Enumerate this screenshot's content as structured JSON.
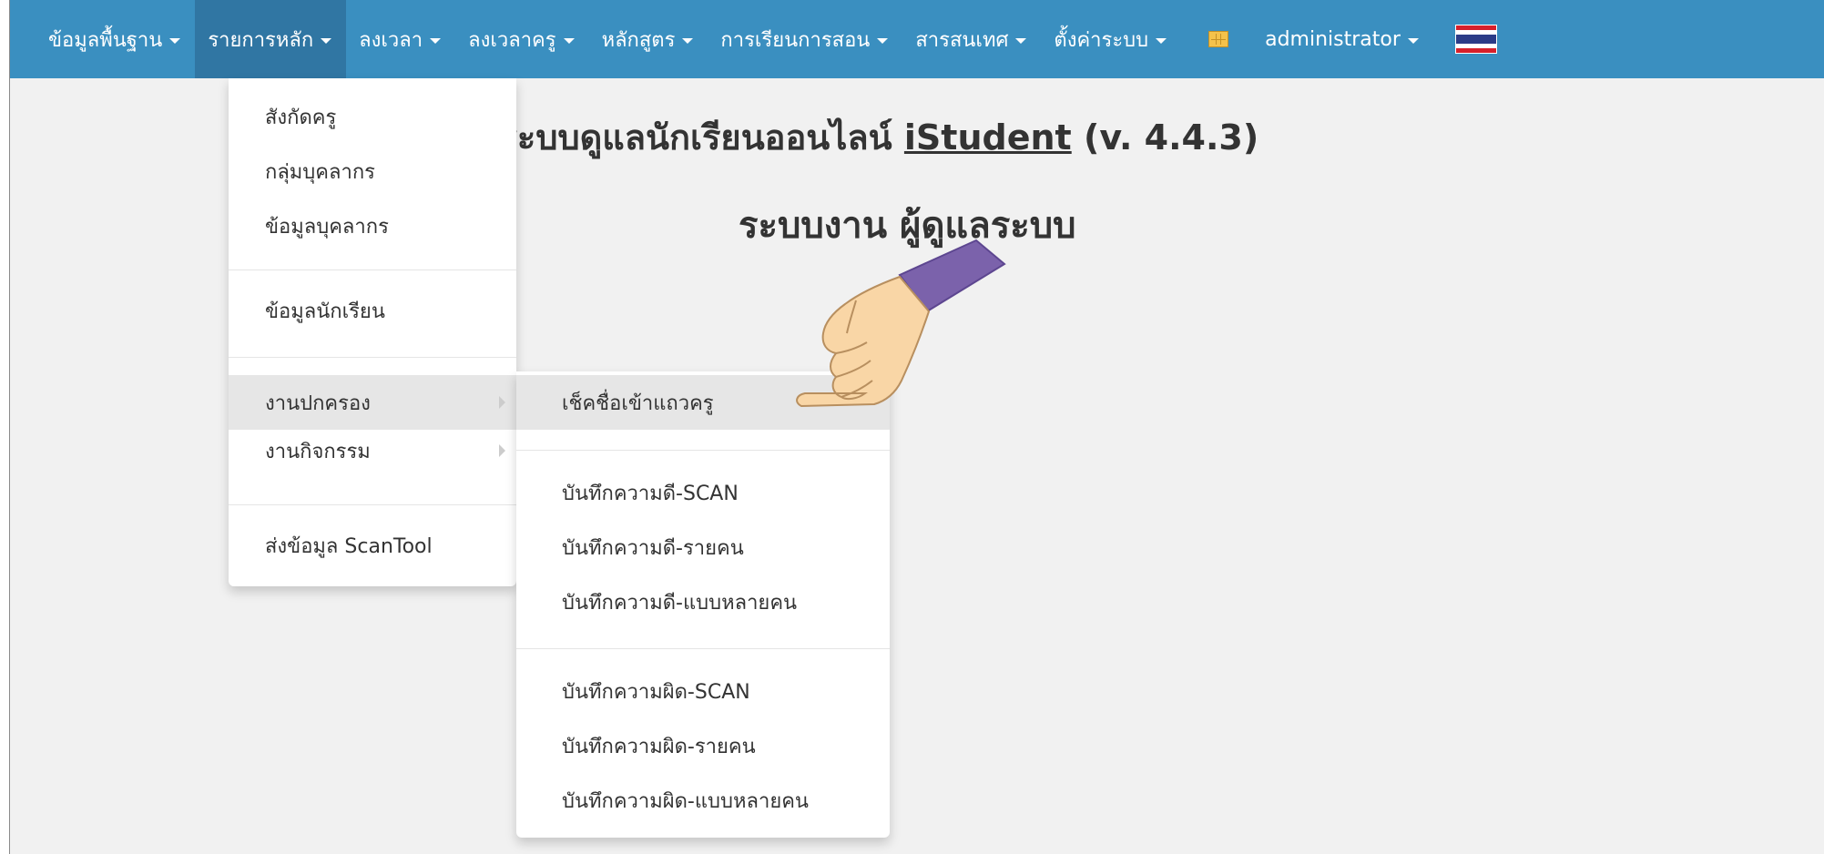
{
  "navbar": {
    "items": [
      {
        "label": "ข้อมูลพื้นฐาน"
      },
      {
        "label": "รายการหลัก"
      },
      {
        "label": "ลงเวลา"
      },
      {
        "label": "ลงเวลาครู"
      },
      {
        "label": "หลักสูตร"
      },
      {
        "label": "การเรียนการสอน"
      },
      {
        "label": "สารสนเทศ"
      },
      {
        "label": "ตั้งค่าระบบ"
      }
    ],
    "apps_icon": "grid-icon",
    "user": "administrator",
    "language_flag": "thai-flag-icon"
  },
  "main": {
    "welcome_prefix": "อนรับสู่ระบบดูแลนักเรียนออนไลน์",
    "welcome_brand": "iStudent",
    "welcome_version": "(v. 4.4.3)",
    "role_title": "ระบบงาน ผู้ดูแลระบบ"
  },
  "dropdown": {
    "items": [
      {
        "label": "สังกัดครู"
      },
      {
        "label": "กลุ่มบุคลากร"
      },
      {
        "label": "ข้อมูลบุคลากร"
      },
      {
        "label": "ข้อมูลนักเรียน"
      },
      {
        "label": "งานปกครอง"
      },
      {
        "label": "งานกิจกรรม"
      },
      {
        "label": "ส่งข้อมูล ScanTool"
      }
    ]
  },
  "submenu": {
    "items": [
      {
        "label": "เช็คชื่อเข้าแถวครู"
      },
      {
        "label": "บันทึกความดี-SCAN"
      },
      {
        "label": "บันทึกความดี-รายคน"
      },
      {
        "label": "บันทึกความดี-แบบหลายคน"
      },
      {
        "label": "บันทึกความผิด-SCAN"
      },
      {
        "label": "บันทึกความผิด-รายคน"
      },
      {
        "label": "บันทึกความผิด-แบบหลายคน"
      }
    ]
  },
  "colors": {
    "navbar": "#3a8fc0",
    "navbar_active": "#3076a3",
    "background": "#f1f1f1",
    "menu_hover": "#e6e6e6",
    "sleeve": "#7b62ab",
    "skin": "#f9d6a6"
  }
}
